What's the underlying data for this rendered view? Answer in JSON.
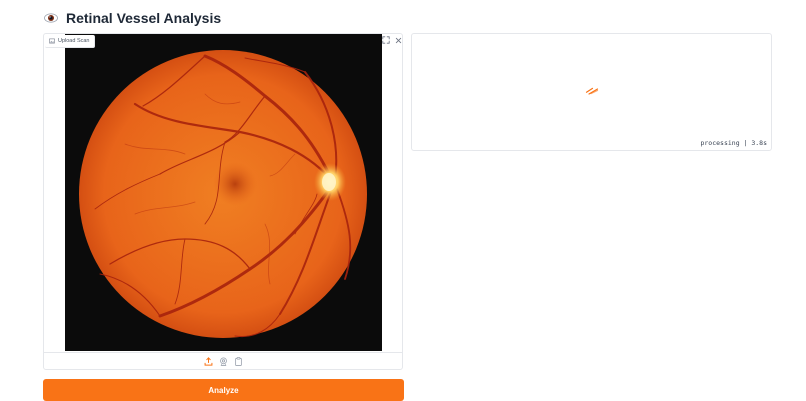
{
  "app": {
    "title": "Retinal Vessel Analysis",
    "title_icon": "eye-icon"
  },
  "upload": {
    "label": "Upload Scan",
    "label_icon": "image-icon",
    "expand_icon": "expand-icon",
    "close_icon": "close-icon",
    "image_subject": "retinal fundus scan",
    "toolbar_icons": [
      "upload-icon",
      "webcam-icon",
      "clipboard-icon"
    ]
  },
  "result": {
    "loading_icon": "loading-icon",
    "status": "processing | 3.8s"
  },
  "actions": {
    "analyze_label": "Analyze"
  },
  "colors": {
    "accent": "#f97316",
    "border": "#e5e7eb",
    "text": "#1f2937",
    "fundus_orange": "#e8641a",
    "image_background": "#0b0b0b"
  }
}
